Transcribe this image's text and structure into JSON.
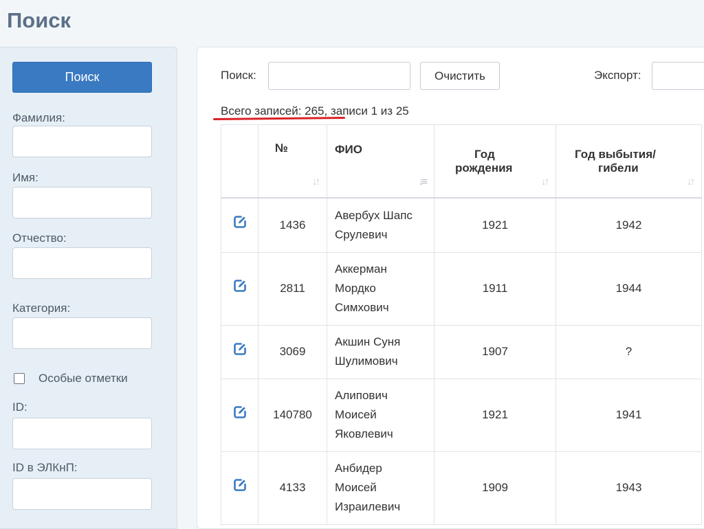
{
  "page": {
    "title": "Поиск"
  },
  "sidebar": {
    "search_button": "Поиск",
    "fields": {
      "last_name": "Фамилия:",
      "first_name": "Имя:",
      "patronymic": "Отчество:",
      "category": "Категория:",
      "special_marks": "Особые отметки",
      "id": "ID:",
      "elkn_id": "ID в ЭЛКнП:"
    }
  },
  "toolbar": {
    "search_label": "Поиск:",
    "clear_button": "Очистить",
    "export_label": "Экспорт:"
  },
  "summary": {
    "text": "Всего записей: 265, записи 1 из 25"
  },
  "table": {
    "headers": {
      "num": "№",
      "fio": "ФИО",
      "birth_line1": "Год",
      "birth_line2": "рождения",
      "death_line1": "Год выбытия/",
      "death_line2": "гибели"
    },
    "rows": [
      {
        "num": "1436",
        "name_lines": [
          "Авербух Шапс",
          "Срулевич"
        ],
        "birth": "1921",
        "death": "1942"
      },
      {
        "num": "2811",
        "name_lines": [
          "Аккерман",
          "Мордко",
          "Симхович"
        ],
        "birth": "1911",
        "death": "1944"
      },
      {
        "num": "3069",
        "name_lines": [
          "Акшин Суня",
          "Шулимович"
        ],
        "birth": "1907",
        "death": "?"
      },
      {
        "num": "140780",
        "name_lines": [
          "Алипович",
          "Моисей",
          "Яковлевич"
        ],
        "birth": "1921",
        "death": "1941"
      },
      {
        "num": "4133",
        "name_lines": [
          "Анбидер",
          "Моисей",
          "Израилевич"
        ],
        "birth": "1909",
        "death": "1943"
      }
    ]
  },
  "colors": {
    "primary": "#3a7ac2",
    "title": "#5c7088",
    "underline": "#d92228",
    "icon": "#3a7ac2"
  }
}
